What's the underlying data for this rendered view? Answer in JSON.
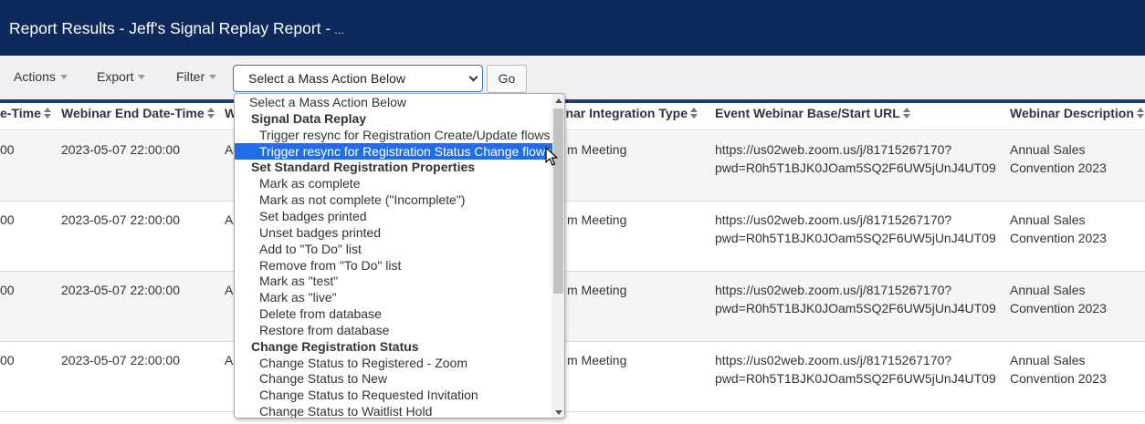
{
  "header": {
    "title": "Report Results - Jeff's Signal Replay Report -",
    "ellipsis": "..."
  },
  "toolbar": {
    "actions_label": "Actions",
    "export_label": "Export",
    "filter_label": "Filter",
    "mass_action_select": "Select a Mass Action Below",
    "go_label": "Go"
  },
  "table": {
    "headers": [
      "e-Time",
      "Webinar End Date-Time",
      "W",
      "binar Integration Type",
      "Event Webinar Base/Start URL",
      "Webinar Description"
    ],
    "rows": [
      {
        "c0": "00",
        "c1": "2023-05-07 22:00:00",
        "c2": "A",
        "c3": "m Meeting",
        "c4a": "https://us02web.zoom.us/j/81715267170?",
        "c4b": "pwd=R0h5T1BJK0JOam5SQ2F6UW5jUnJ4UT09",
        "c5a": "Annual Sales",
        "c5b": "Convention 2023"
      },
      {
        "c0": "00",
        "c1": "2023-05-07 22:00:00",
        "c2": "A",
        "c3": "m Meeting",
        "c4a": "https://us02web.zoom.us/j/81715267170?",
        "c4b": "pwd=R0h5T1BJK0JOam5SQ2F6UW5jUnJ4UT09",
        "c5a": "Annual Sales",
        "c5b": "Convention 2023"
      },
      {
        "c0": "00",
        "c1": "2023-05-07 22:00:00",
        "c2": "A",
        "c3": "m Meeting",
        "c4a": "https://us02web.zoom.us/j/81715267170?",
        "c4b": "pwd=R0h5T1BJK0JOam5SQ2F6UW5jUnJ4UT09",
        "c5a": "Annual Sales",
        "c5b": "Convention 2023"
      },
      {
        "c0": "00",
        "c1": "2023-05-07 22:00:00",
        "c2": "A",
        "c3": "m Meeting",
        "c4a": "https://us02web.zoom.us/j/81715267170?",
        "c4b": "pwd=R0h5T1BJK0JOam5SQ2F6UW5jUnJ4UT09",
        "c5a": "Annual Sales",
        "c5b": "Convention 2023"
      }
    ]
  },
  "dropdown": {
    "items": [
      {
        "type": "first",
        "label": "Select a Mass Action Below"
      },
      {
        "type": "group",
        "label": "Signal Data Replay"
      },
      {
        "type": "opt",
        "label": "Trigger resync for Registration Create/Update flows"
      },
      {
        "type": "opt",
        "label": "Trigger resync for Registration Status Change flows",
        "selected": true
      },
      {
        "type": "group",
        "label": "Set Standard Registration Properties"
      },
      {
        "type": "opt",
        "label": "Mark as complete"
      },
      {
        "type": "opt",
        "label": "Mark as not complete (\"Incomplete\")"
      },
      {
        "type": "opt",
        "label": "Set badges printed"
      },
      {
        "type": "opt",
        "label": "Unset badges printed"
      },
      {
        "type": "opt",
        "label": "Add to \"To Do\" list"
      },
      {
        "type": "opt",
        "label": "Remove from \"To Do\" list"
      },
      {
        "type": "opt",
        "label": "Mark as \"test\""
      },
      {
        "type": "opt",
        "label": "Mark as \"live\""
      },
      {
        "type": "opt",
        "label": "Delete from database"
      },
      {
        "type": "opt",
        "label": "Restore from database"
      },
      {
        "type": "group",
        "label": "Change Registration Status"
      },
      {
        "type": "opt",
        "label": "Change Status to Registered - Zoom"
      },
      {
        "type": "opt",
        "label": "Change Status to New"
      },
      {
        "type": "opt",
        "label": "Change Status to Requested Invitation"
      },
      {
        "type": "opt",
        "label": "Change Status to Waitlist Hold"
      }
    ]
  },
  "colors": {
    "header_bg": "#0e2a5c",
    "accent_bar": "#1a3e7a",
    "selected_option": "#1e6fe6"
  }
}
